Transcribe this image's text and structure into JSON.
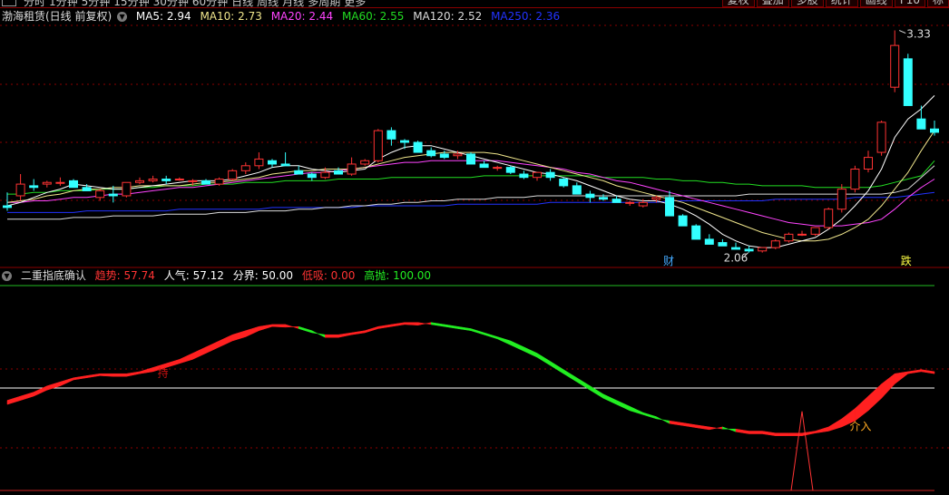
{
  "top_tabs": [
    "分时",
    "1分钟",
    "5分钟",
    "15分钟",
    "30分钟",
    "60分钟",
    "日线",
    "周线",
    "月线",
    "多周期",
    "更多"
  ],
  "top_buttons": [
    "复权",
    "叠加",
    "多股",
    "统计",
    "画线",
    "F10",
    "标"
  ],
  "main_legend": {
    "stock": "渤海租赁(日线 前复权)",
    "ma5": "MA5: 2.94",
    "ma10": "MA10: 2.73",
    "ma20": "MA20: 2.44",
    "ma60": "MA60: 2.55",
    "ma120": "MA120: 2.52",
    "ma250": "MA250: 2.36"
  },
  "colors": {
    "ma5": "#ffffff",
    "ma10": "#f0e68c",
    "ma20": "#ff44ff",
    "ma60": "#22dd22",
    "ma120": "#dcdcdc",
    "ma250": "#2233ff",
    "up": "#ff3333",
    "down": "#33ffff",
    "bull": "#ff2020",
    "bear": "#22ee22",
    "grid": "#8b0000"
  },
  "price_high_label": "3.33",
  "price_low_label": "2.06",
  "marker_cai": "财",
  "marker_die": "跌",
  "indicator_legend": {
    "name": "二重指底确认",
    "trend": "趋势: 57.74",
    "sentiment": "人气: 57.12",
    "boundary": "分界: 50.00",
    "low_buy": "低吸: 0.00",
    "high_sell": "高抛: 100.00"
  },
  "indicator_annotations": {
    "hold": "持",
    "enter": "介入"
  },
  "chart_data": {
    "type": "candlestick",
    "candles": [
      [
        2.28,
        2.36,
        2.25,
        2.27
      ],
      [
        2.34,
        2.47,
        2.31,
        2.41
      ],
      [
        2.4,
        2.44,
        2.37,
        2.39
      ],
      [
        2.41,
        2.43,
        2.39,
        2.42
      ],
      [
        2.42,
        2.45,
        2.4,
        2.42
      ],
      [
        2.43,
        2.44,
        2.4,
        2.39
      ],
      [
        2.39,
        2.41,
        2.37,
        2.37
      ],
      [
        2.33,
        2.38,
        2.31,
        2.37
      ],
      [
        2.35,
        2.4,
        2.3,
        2.34
      ],
      [
        2.34,
        2.42,
        2.33,
        2.42
      ],
      [
        2.42,
        2.45,
        2.41,
        2.43
      ],
      [
        2.43,
        2.46,
        2.42,
        2.44
      ],
      [
        2.44,
        2.46,
        2.41,
        2.43
      ],
      [
        2.44,
        2.45,
        2.43,
        2.44
      ],
      [
        2.43,
        2.44,
        2.4,
        2.43
      ],
      [
        2.43,
        2.44,
        2.41,
        2.41
      ],
      [
        2.41,
        2.45,
        2.4,
        2.44
      ],
      [
        2.44,
        2.5,
        2.43,
        2.49
      ],
      [
        2.49,
        2.54,
        2.47,
        2.52
      ],
      [
        2.52,
        2.6,
        2.5,
        2.56
      ],
      [
        2.55,
        2.56,
        2.51,
        2.53
      ],
      [
        2.53,
        2.6,
        2.52,
        2.52
      ],
      [
        2.49,
        2.52,
        2.48,
        2.47
      ],
      [
        2.47,
        2.48,
        2.43,
        2.45
      ],
      [
        2.45,
        2.51,
        2.44,
        2.48
      ],
      [
        2.49,
        2.51,
        2.47,
        2.47
      ],
      [
        2.47,
        2.57,
        2.46,
        2.53
      ],
      [
        2.53,
        2.56,
        2.52,
        2.55
      ],
      [
        2.55,
        2.74,
        2.54,
        2.73
      ],
      [
        2.73,
        2.75,
        2.64,
        2.68
      ],
      [
        2.67,
        2.68,
        2.62,
        2.66
      ],
      [
        2.66,
        2.67,
        2.6,
        2.6
      ],
      [
        2.61,
        2.63,
        2.57,
        2.58
      ],
      [
        2.59,
        2.61,
        2.56,
        2.57
      ],
      [
        2.58,
        2.61,
        2.56,
        2.59
      ],
      [
        2.59,
        2.6,
        2.55,
        2.53
      ],
      [
        2.53,
        2.55,
        2.52,
        2.51
      ],
      [
        2.51,
        2.52,
        2.49,
        2.51
      ],
      [
        2.51,
        2.52,
        2.47,
        2.48
      ],
      [
        2.47,
        2.49,
        2.44,
        2.45
      ],
      [
        2.45,
        2.48,
        2.43,
        2.48
      ],
      [
        2.48,
        2.5,
        2.43,
        2.45
      ],
      [
        2.44,
        2.45,
        2.39,
        2.4
      ],
      [
        2.4,
        2.42,
        2.36,
        2.35
      ],
      [
        2.35,
        2.37,
        2.3,
        2.33
      ],
      [
        2.33,
        2.35,
        2.31,
        2.32
      ],
      [
        2.32,
        2.34,
        2.3,
        2.3
      ],
      [
        2.3,
        2.31,
        2.28,
        2.3
      ],
      [
        2.28,
        2.32,
        2.27,
        2.3
      ],
      [
        2.32,
        2.34,
        2.3,
        2.33
      ],
      [
        2.33,
        2.37,
        2.31,
        2.22
      ],
      [
        2.22,
        2.23,
        2.18,
        2.16
      ],
      [
        2.16,
        2.17,
        2.12,
        2.08
      ],
      [
        2.08,
        2.11,
        2.06,
        2.05
      ],
      [
        2.06,
        2.08,
        2.04,
        2.04
      ],
      [
        2.03,
        2.06,
        2.03,
        2.02
      ],
      [
        2.02,
        2.04,
        2.0,
        2.01
      ],
      [
        2.01,
        2.03,
        2.0,
        2.03
      ],
      [
        2.03,
        2.08,
        2.02,
        2.07
      ],
      [
        2.07,
        2.12,
        2.06,
        2.11
      ],
      [
        2.11,
        2.13,
        2.1,
        2.11
      ],
      [
        2.11,
        2.15,
        2.1,
        2.15
      ],
      [
        2.15,
        2.27,
        2.14,
        2.26
      ],
      [
        2.26,
        2.41,
        2.24,
        2.38
      ],
      [
        2.38,
        2.52,
        2.36,
        2.5
      ],
      [
        2.5,
        2.61,
        2.48,
        2.57
      ],
      [
        2.6,
        2.79,
        2.58,
        2.78
      ],
      [
        2.99,
        3.33,
        2.96,
        3.24
      ],
      [
        3.16,
        3.19,
        2.88,
        2.88
      ],
      [
        2.8,
        2.88,
        2.76,
        2.74
      ],
      [
        2.74,
        2.79,
        2.7,
        2.72
      ]
    ],
    "ma5": [
      2.28,
      2.3,
      2.33,
      2.36,
      2.38,
      2.41,
      2.4,
      2.39,
      2.38,
      2.38,
      2.39,
      2.4,
      2.41,
      2.42,
      2.43,
      2.43,
      2.43,
      2.44,
      2.46,
      2.48,
      2.51,
      2.52,
      2.52,
      2.5,
      2.49,
      2.48,
      2.49,
      2.5,
      2.56,
      2.6,
      2.63,
      2.64,
      2.64,
      2.62,
      2.6,
      2.58,
      2.56,
      2.54,
      2.52,
      2.5,
      2.48,
      2.47,
      2.45,
      2.43,
      2.4,
      2.37,
      2.34,
      2.32,
      2.31,
      2.31,
      2.29,
      2.26,
      2.22,
      2.17,
      2.11,
      2.07,
      2.04,
      2.03,
      2.03,
      2.05,
      2.07,
      2.09,
      2.14,
      2.2,
      2.28,
      2.37,
      2.5,
      2.69,
      2.8,
      2.86,
      2.94
    ],
    "ma10": [
      2.3,
      2.31,
      2.32,
      2.34,
      2.35,
      2.37,
      2.38,
      2.38,
      2.39,
      2.39,
      2.4,
      2.4,
      2.4,
      2.4,
      2.41,
      2.42,
      2.42,
      2.43,
      2.44,
      2.45,
      2.47,
      2.48,
      2.49,
      2.49,
      2.5,
      2.5,
      2.5,
      2.51,
      2.53,
      2.55,
      2.57,
      2.58,
      2.59,
      2.6,
      2.6,
      2.6,
      2.6,
      2.59,
      2.57,
      2.55,
      2.53,
      2.51,
      2.49,
      2.47,
      2.45,
      2.43,
      2.4,
      2.38,
      2.36,
      2.34,
      2.32,
      2.3,
      2.27,
      2.24,
      2.21,
      2.18,
      2.15,
      2.12,
      2.1,
      2.08,
      2.07,
      2.07,
      2.08,
      2.11,
      2.15,
      2.2,
      2.28,
      2.38,
      2.48,
      2.61,
      2.73
    ],
    "ma20": [
      2.3,
      2.3,
      2.31,
      2.31,
      2.32,
      2.33,
      2.33,
      2.34,
      2.35,
      2.35,
      2.36,
      2.37,
      2.38,
      2.39,
      2.39,
      2.4,
      2.41,
      2.42,
      2.43,
      2.44,
      2.45,
      2.46,
      2.47,
      2.48,
      2.48,
      2.49,
      2.5,
      2.51,
      2.52,
      2.53,
      2.54,
      2.54,
      2.55,
      2.55,
      2.55,
      2.55,
      2.55,
      2.55,
      2.54,
      2.53,
      2.52,
      2.51,
      2.5,
      2.48,
      2.47,
      2.45,
      2.43,
      2.42,
      2.4,
      2.38,
      2.36,
      2.34,
      2.32,
      2.3,
      2.28,
      2.26,
      2.24,
      2.22,
      2.2,
      2.18,
      2.17,
      2.16,
      2.16,
      2.16,
      2.17,
      2.18,
      2.2,
      2.26,
      2.33,
      2.39,
      2.44
    ],
    "ma60": [
      2.35,
      2.35,
      2.36,
      2.36,
      2.37,
      2.37,
      2.37,
      2.38,
      2.38,
      2.38,
      2.39,
      2.39,
      2.4,
      2.4,
      2.4,
      2.41,
      2.41,
      2.41,
      2.42,
      2.42,
      2.42,
      2.43,
      2.43,
      2.43,
      2.43,
      2.44,
      2.44,
      2.44,
      2.44,
      2.45,
      2.45,
      2.45,
      2.45,
      2.45,
      2.45,
      2.45,
      2.46,
      2.46,
      2.46,
      2.46,
      2.46,
      2.46,
      2.46,
      2.46,
      2.46,
      2.45,
      2.45,
      2.45,
      2.45,
      2.44,
      2.44,
      2.43,
      2.43,
      2.42,
      2.42,
      2.41,
      2.41,
      2.4,
      2.4,
      2.4,
      2.4,
      2.39,
      2.39,
      2.39,
      2.39,
      2.39,
      2.4,
      2.42,
      2.44,
      2.46,
      2.55
    ],
    "ma120": [
      2.2,
      2.2,
      2.2,
      2.2,
      2.2,
      2.21,
      2.21,
      2.21,
      2.22,
      2.22,
      2.22,
      2.22,
      2.23,
      2.23,
      2.23,
      2.23,
      2.24,
      2.24,
      2.24,
      2.25,
      2.25,
      2.25,
      2.26,
      2.26,
      2.27,
      2.27,
      2.28,
      2.28,
      2.29,
      2.29,
      2.3,
      2.3,
      2.31,
      2.31,
      2.32,
      2.32,
      2.32,
      2.33,
      2.33,
      2.33,
      2.34,
      2.34,
      2.34,
      2.34,
      2.34,
      2.34,
      2.34,
      2.34,
      2.34,
      2.34,
      2.34,
      2.34,
      2.34,
      2.34,
      2.34,
      2.34,
      2.35,
      2.35,
      2.35,
      2.35,
      2.35,
      2.35,
      2.35,
      2.35,
      2.35,
      2.35,
      2.35,
      2.36,
      2.38,
      2.45,
      2.52
    ],
    "ma250": [
      2.24,
      2.24,
      2.24,
      2.24,
      2.24,
      2.24,
      2.25,
      2.25,
      2.25,
      2.25,
      2.25,
      2.25,
      2.25,
      2.26,
      2.26,
      2.26,
      2.26,
      2.26,
      2.26,
      2.26,
      2.27,
      2.27,
      2.27,
      2.27,
      2.27,
      2.27,
      2.27,
      2.28,
      2.28,
      2.28,
      2.28,
      2.28,
      2.28,
      2.28,
      2.29,
      2.29,
      2.29,
      2.29,
      2.29,
      2.29,
      2.29,
      2.3,
      2.3,
      2.3,
      2.3,
      2.3,
      2.3,
      2.3,
      2.3,
      2.3,
      2.31,
      2.31,
      2.31,
      2.31,
      2.31,
      2.31,
      2.31,
      2.31,
      2.32,
      2.32,
      2.32,
      2.32,
      2.32,
      2.32,
      2.33,
      2.33,
      2.33,
      2.33,
      2.34,
      2.35,
      2.36
    ],
    "indicator_trend": [
      44,
      46,
      48,
      51,
      53,
      55,
      56,
      57,
      57,
      57,
      58,
      60,
      62,
      64,
      67,
      70,
      73,
      76,
      78,
      80,
      81,
      81,
      79,
      77,
      76,
      76,
      77,
      78,
      80,
      81,
      82,
      82,
      81,
      80,
      79,
      78,
      76,
      74,
      71,
      68,
      65,
      61,
      57,
      53,
      49,
      45,
      42,
      39,
      37,
      35,
      34,
      33,
      32,
      31,
      30,
      30,
      29,
      29,
      28,
      28,
      28,
      29,
      31,
      35,
      40,
      46,
      52,
      57,
      58,
      59,
      58
    ],
    "indicator_sentiment": [
      42,
      44,
      46,
      49,
      51,
      54,
      55,
      56,
      57,
      57,
      57,
      58,
      60,
      62,
      64,
      67,
      70,
      73,
      75,
      78,
      80,
      81,
      80,
      78,
      76,
      76,
      76,
      77,
      79,
      80,
      81,
      82,
      82,
      81,
      80,
      79,
      77,
      75,
      73,
      70,
      67,
      63,
      59,
      55,
      51,
      47,
      44,
      41,
      38,
      36,
      34,
      33,
      32,
      31,
      31,
      30,
      29,
      29,
      28,
      28,
      28,
      28,
      29,
      31,
      34,
      39,
      45,
      52,
      57,
      58,
      57
    ],
    "indicator_levels": {
      "low_buy": 0,
      "boundary": 50,
      "high_sell": 100
    },
    "marker_cai_index": 50,
    "marker_die_index": 68
  }
}
